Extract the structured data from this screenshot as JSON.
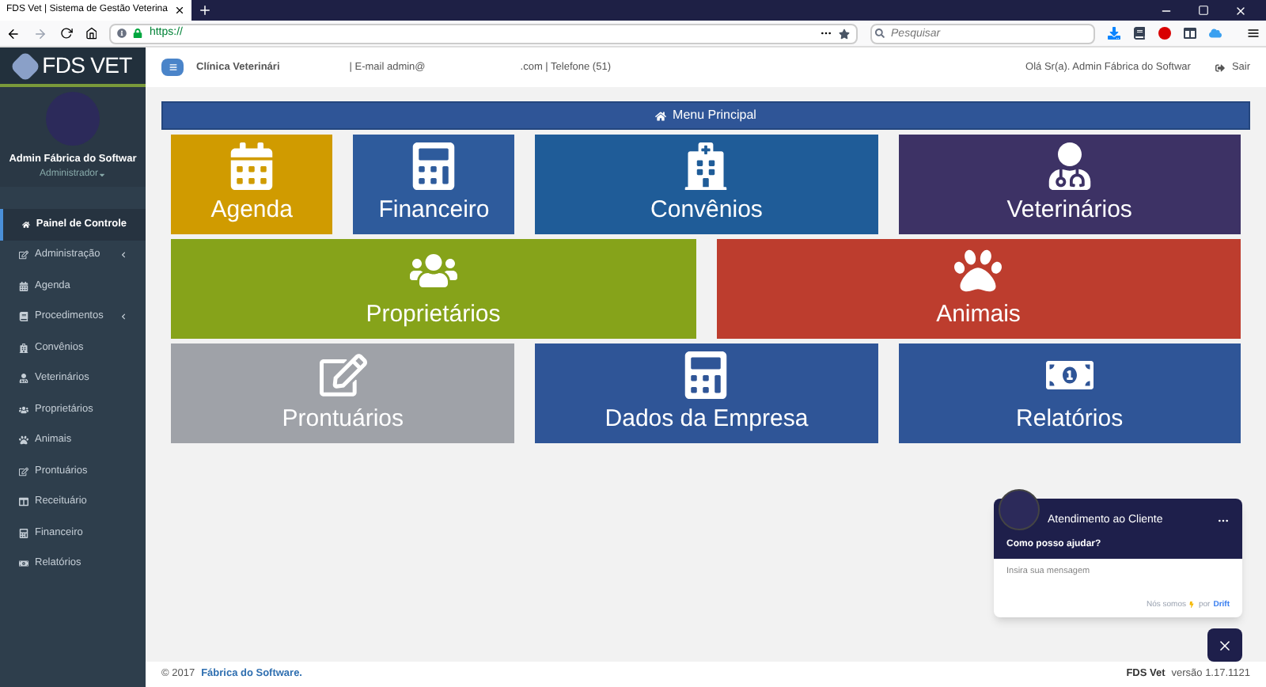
{
  "browser": {
    "tab_title": "FDS Vet | Sistema de Gestão Veterina",
    "url": "https://",
    "search_placeholder": "Pesquisar"
  },
  "sidebar": {
    "logo": "FDS VET",
    "user_name": "Admin Fábrica do Softwar",
    "user_role": "Administrador",
    "items": [
      {
        "label": "Painel de Controle",
        "selected": true,
        "expandable": false
      },
      {
        "label": "Administração",
        "selected": false,
        "expandable": true
      },
      {
        "label": "Agenda",
        "selected": false,
        "expandable": false
      },
      {
        "label": "Procedimentos",
        "selected": false,
        "expandable": true
      },
      {
        "label": "Convênios",
        "selected": false,
        "expandable": false
      },
      {
        "label": "Veterinários",
        "selected": false,
        "expandable": false
      },
      {
        "label": "Proprietários",
        "selected": false,
        "expandable": false
      },
      {
        "label": "Animais",
        "selected": false,
        "expandable": false
      },
      {
        "label": "Prontuários",
        "selected": false,
        "expandable": false
      },
      {
        "label": "Receituário",
        "selected": false,
        "expandable": false
      },
      {
        "label": "Financeiro",
        "selected": false,
        "expandable": false
      },
      {
        "label": "Relatórios",
        "selected": false,
        "expandable": false
      }
    ]
  },
  "header": {
    "clinic_label": "Clínica Veterinári",
    "email": "| E-mail admin@",
    "telefone": ".com | Telefone (51)",
    "greeting": "Olá Sr(a). Admin Fábrica do Softwar",
    "logout": "Sair"
  },
  "menu_title": "Menu Principal",
  "tile_rows": [
    {
      "tiles": [
        {
          "label": "Agenda",
          "color": "#d09b00"
        },
        {
          "label": "Financeiro",
          "color": "#2e5b9c"
        },
        {
          "label": "Convênios",
          "color": "#1f5c98"
        },
        {
          "label": "Veterinários",
          "color": "#3d3265"
        }
      ]
    },
    {
      "tiles": [
        {
          "label": "Proprietários",
          "color": "#86a31a"
        },
        {
          "label": "Animais",
          "color": "#bd3d2e"
        }
      ]
    },
    {
      "tiles": [
        {
          "label": "Prontuários",
          "color": "#9fa2a8"
        },
        {
          "label": "Dados da Empresa",
          "color": "#2f5597"
        },
        {
          "label": "Relatórios",
          "color": "#2f5597"
        }
      ]
    }
  ],
  "chat": {
    "title": "Atendimento ao Cliente",
    "prompt": "Como posso ajudar?",
    "placeholder": "Insira sua mensagem",
    "powered": "Nós somos",
    "powered_by": "por",
    "brand": "Drift"
  },
  "footer": {
    "copyright": "© 2017",
    "company": "Fábrica do Software.",
    "app": "FDS Vet",
    "version": "versão 1.17.1121"
  }
}
